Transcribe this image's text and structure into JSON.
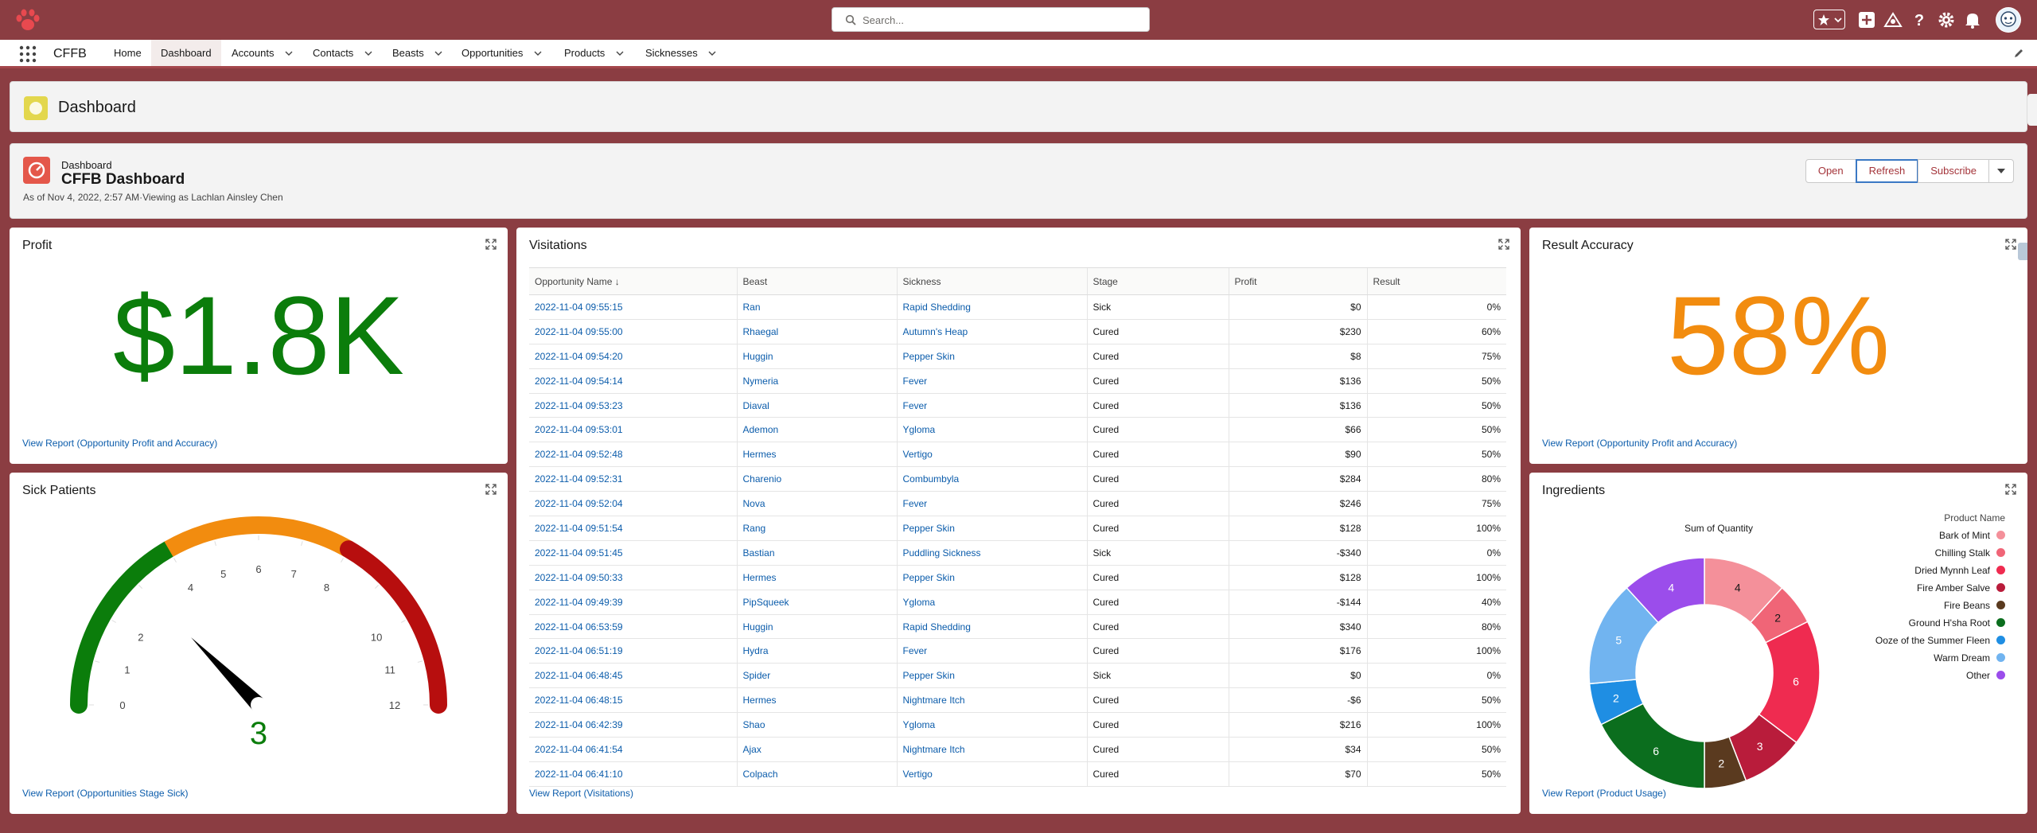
{
  "header": {
    "search_placeholder": "Search..."
  },
  "nav": {
    "app_name": "CFFB",
    "items": [
      {
        "label": "Home",
        "dropdown": false,
        "active": false
      },
      {
        "label": "Dashboard",
        "dropdown": false,
        "active": true
      },
      {
        "label": "Accounts",
        "dropdown": true,
        "active": false
      },
      {
        "label": "Contacts",
        "dropdown": true,
        "active": false
      },
      {
        "label": "Beasts",
        "dropdown": true,
        "active": false
      },
      {
        "label": "Opportunities",
        "dropdown": true,
        "active": false
      },
      {
        "label": "Products",
        "dropdown": true,
        "active": false
      },
      {
        "label": "Sicknesses",
        "dropdown": true,
        "active": false
      }
    ]
  },
  "page": {
    "object_title": "Dashboard"
  },
  "dashboard": {
    "type_label": "Dashboard",
    "name": "CFFB Dashboard",
    "as_of": "As of Nov 4, 2022, 2:57 AM·Viewing as Lachlan Ainsley Chen",
    "buttons": {
      "open": "Open",
      "refresh": "Refresh",
      "subscribe": "Subscribe"
    }
  },
  "profit": {
    "title": "Profit",
    "value": "$1.8K",
    "color": "#0b7d0b",
    "link": "View Report (Opportunity Profit and Accuracy)"
  },
  "sick_patients": {
    "title": "Sick Patients",
    "value": "3",
    "gauge_min": 0,
    "gauge_max": 12,
    "ticks": [
      "0",
      "1",
      "2",
      "4",
      "5",
      "6",
      "7",
      "8",
      "10",
      "11",
      "12"
    ],
    "segments": [
      {
        "from": 0,
        "to": 4,
        "color": "#0b7d0b"
      },
      {
        "from": 4,
        "to": 8,
        "color": "#f28c0f"
      },
      {
        "from": 8,
        "to": 12,
        "color": "#b70e0e"
      }
    ],
    "link": "View Report (Opportunities Stage Sick)"
  },
  "visitations": {
    "title": "Visitations",
    "columns": [
      "Opportunity Name ↓",
      "Beast",
      "Sickness",
      "Stage",
      "Profit",
      "Result"
    ],
    "rows": [
      [
        "2022-11-04 09:55:15",
        "Ran",
        "Rapid Shedding",
        "Sick",
        "$0",
        "0%"
      ],
      [
        "2022-11-04 09:55:00",
        "Rhaegal",
        "Autumn's Heap",
        "Cured",
        "$230",
        "60%"
      ],
      [
        "2022-11-04 09:54:20",
        "Huggin",
        "Pepper Skin",
        "Cured",
        "$8",
        "75%"
      ],
      [
        "2022-11-04 09:54:14",
        "Nymeria",
        "Fever",
        "Cured",
        "$136",
        "50%"
      ],
      [
        "2022-11-04 09:53:23",
        "Diaval",
        "Fever",
        "Cured",
        "$136",
        "50%"
      ],
      [
        "2022-11-04 09:53:01",
        "Ademon",
        "Ygloma",
        "Cured",
        "$66",
        "50%"
      ],
      [
        "2022-11-04 09:52:48",
        "Hermes",
        "Vertigo",
        "Cured",
        "$90",
        "50%"
      ],
      [
        "2022-11-04 09:52:31",
        "Charenio",
        "Combumbyla",
        "Cured",
        "$284",
        "80%"
      ],
      [
        "2022-11-04 09:52:04",
        "Nova",
        "Fever",
        "Cured",
        "$246",
        "75%"
      ],
      [
        "2022-11-04 09:51:54",
        "Rang",
        "Pepper Skin",
        "Cured",
        "$128",
        "100%"
      ],
      [
        "2022-11-04 09:51:45",
        "Bastian",
        "Puddling Sickness",
        "Sick",
        "-$340",
        "0%"
      ],
      [
        "2022-11-04 09:50:33",
        "Hermes",
        "Pepper Skin",
        "Cured",
        "$128",
        "100%"
      ],
      [
        "2022-11-04 09:49:39",
        "PipSqueek",
        "Ygloma",
        "Cured",
        "-$144",
        "40%"
      ],
      [
        "2022-11-04 06:53:59",
        "Huggin",
        "Rapid Shedding",
        "Cured",
        "$340",
        "80%"
      ],
      [
        "2022-11-04 06:51:19",
        "Hydra",
        "Fever",
        "Cured",
        "$176",
        "100%"
      ],
      [
        "2022-11-04 06:48:45",
        "Spider",
        "Pepper Skin",
        "Sick",
        "$0",
        "0%"
      ],
      [
        "2022-11-04 06:48:15",
        "Hermes",
        "Nightmare Itch",
        "Cured",
        "-$6",
        "50%"
      ],
      [
        "2022-11-04 06:42:39",
        "Shao",
        "Ygloma",
        "Cured",
        "$216",
        "100%"
      ],
      [
        "2022-11-04 06:41:54",
        "Ajax",
        "Nightmare Itch",
        "Cured",
        "$34",
        "50%"
      ],
      [
        "2022-11-04 06:41:10",
        "Colpach",
        "Vertigo",
        "Cured",
        "$70",
        "50%"
      ]
    ],
    "link": "View Report (Visitations)"
  },
  "result_accuracy": {
    "title": "Result Accuracy",
    "value": "58%",
    "color": "#f28c0f",
    "link": "View Report (Opportunity Profit and Accuracy)"
  },
  "ingredients": {
    "title": "Ingredients",
    "link": "View Report (Product Usage)"
  },
  "chart_data": {
    "type": "pie",
    "variant": "donut",
    "title": "Sum of Quantity",
    "legend_title": "Product Name",
    "legend_position": "right",
    "categories": [
      "Bark of Mint",
      "Chilling Stalk",
      "Dried Mynnh Leaf",
      "Fire Amber Salve",
      "Fire Beans",
      "Ground H'sha Root",
      "Ooze of the Summer Fleen",
      "Warm Dream",
      "Other"
    ],
    "values": [
      4,
      2,
      6,
      3,
      2,
      6,
      2,
      5,
      4
    ],
    "colors": [
      "#f4909a",
      "#f06577",
      "#ef2b50",
      "#b91c3b",
      "#5a3a1f",
      "#0b6e1e",
      "#1f8ee3",
      "#71b4f0",
      "#9b4deb"
    ]
  }
}
